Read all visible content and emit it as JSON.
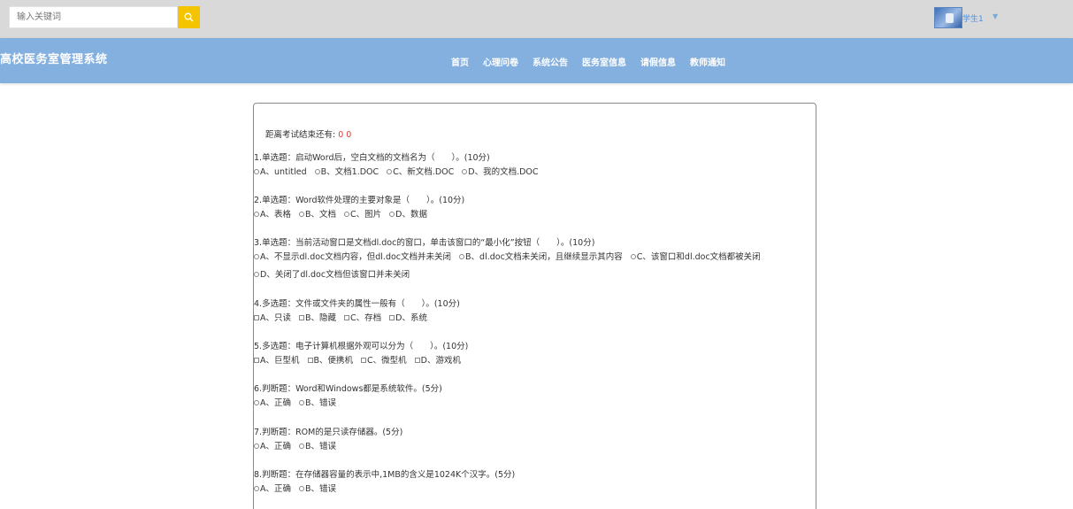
{
  "search": {
    "placeholder": "输入关键词"
  },
  "user": {
    "name": "学生1"
  },
  "brand": {
    "title": "高校医务室管理系统"
  },
  "nav": {
    "items": [
      "首页",
      "心理问卷",
      "系统公告",
      "医务室信息",
      "请假信息",
      "教师通知"
    ]
  },
  "exam": {
    "countdown_label": "距离考试结束还有:",
    "countdown_value": "0 0",
    "questions": [
      {
        "title": "1.单选题：启动Word后，空白文档的文档名为（　　）。(10分)",
        "type": "radio",
        "options": [
          "A、untitled",
          "B、文档1.DOC",
          "C、新文档.DOC",
          "D、我的文档.DOC"
        ]
      },
      {
        "title": "2.单选题：Word软件处理的主要对象是（　　）。(10分)",
        "type": "radio",
        "options": [
          "A、表格",
          "B、文档",
          "C、图片",
          "D、数据"
        ]
      },
      {
        "title": "3.单选题：当前活动窗口是文档dl.doc的窗口，单击该窗口的“最小化”按钮（　　）。(10分)",
        "type": "radio",
        "options": [
          "A、不显示dl.doc文档内容，但dl.doc文档并未关闭",
          "B、dl.doc文档未关闭，且继续显示其内容",
          "C、该窗口和dl.doc文档都被关闭",
          "D、关闭了dl.doc文档但该窗口并未关闭"
        ]
      },
      {
        "title": "4.多选题：文件或文件夹的属性一般有（　　）。(10分)",
        "type": "checkbox",
        "options": [
          "A、只读",
          "B、隐藏",
          "C、存档",
          "D、系统"
        ]
      },
      {
        "title": "5.多选题：电子计算机根据外观可以分为（　　）。(10分)",
        "type": "checkbox",
        "options": [
          "A、巨型机",
          "B、便携机",
          "C、微型机",
          "D、游戏机"
        ]
      },
      {
        "title": "6.判断题：Word和Windows都是系统软件。(5分)",
        "type": "radio",
        "options": [
          "A、正确",
          "B、错误"
        ]
      },
      {
        "title": "7.判断题：ROM的是只读存储器。(5分)",
        "type": "radio",
        "options": [
          "A、正确",
          "B、错误"
        ]
      },
      {
        "title": "8.判断题：在存储器容量的表示中,1MB的含义是1024K个汉字。(5分)",
        "type": "radio",
        "options": [
          "A、正确",
          "B、错误"
        ]
      }
    ]
  },
  "colors": {
    "topbar": "#d9d9d9",
    "navbar": "#84b0e0",
    "search_button": "#f5c400",
    "timer": "#e53935",
    "username": "#4a90e2"
  }
}
